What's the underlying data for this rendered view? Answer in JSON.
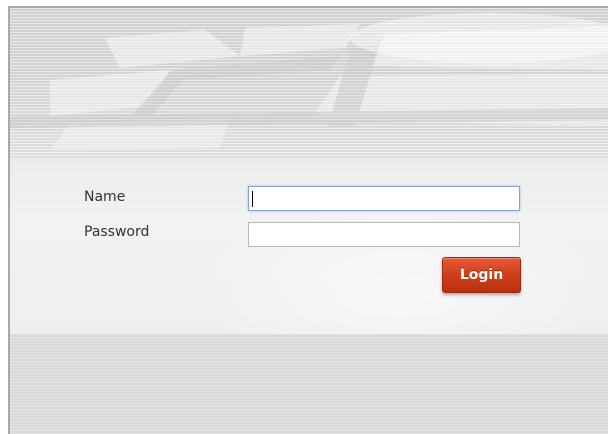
{
  "login_form": {
    "name_label": "Name",
    "name_value": "",
    "password_label": "Password",
    "password_value": "",
    "login_button_label": "Login"
  },
  "colors": {
    "login_button": "#d2401e",
    "focused_input_border": "#7fa7d9",
    "background": "#e4e4e4"
  }
}
